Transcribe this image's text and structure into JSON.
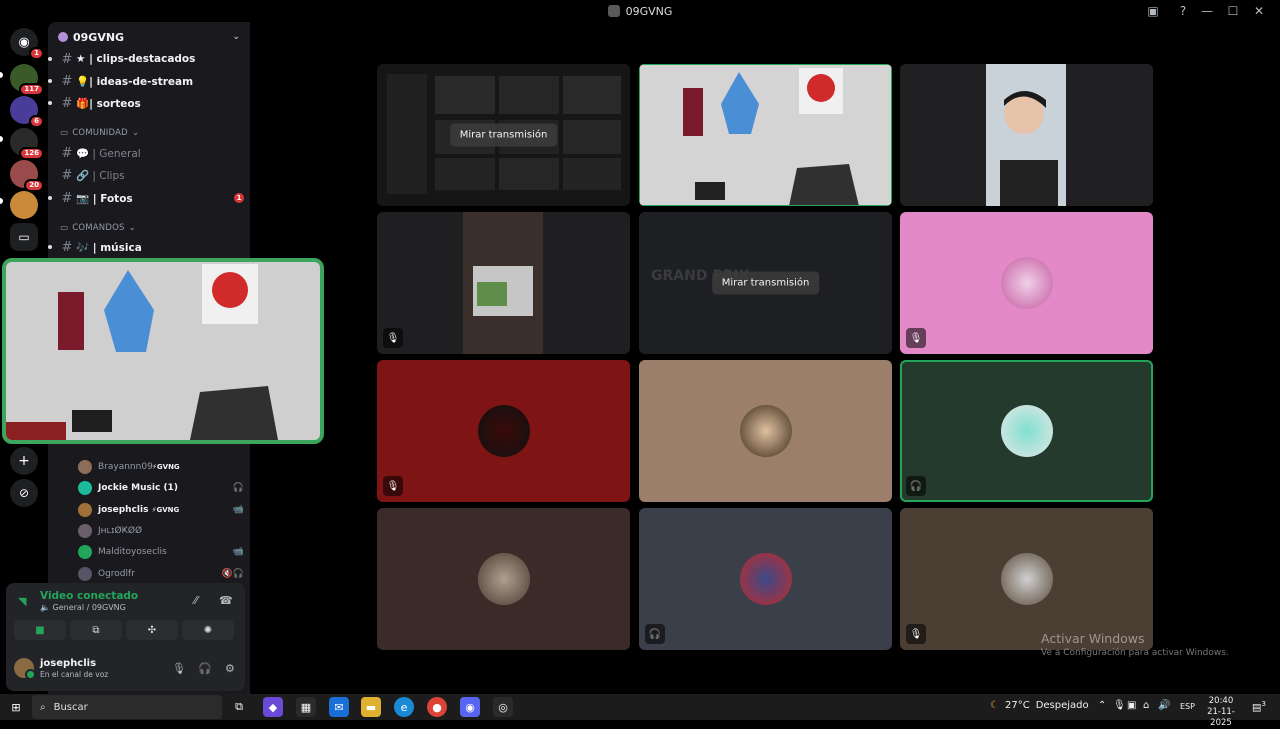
{
  "window": {
    "title": "09GVNG"
  },
  "rail": {
    "badges": [
      "1",
      "117",
      "6",
      "126",
      "20"
    ]
  },
  "guild": {
    "name": "09GVNG"
  },
  "channels": [
    {
      "name": "★ | clips-destacados",
      "muted": false
    },
    {
      "name": "💡| ideas-de-stream",
      "muted": false
    },
    {
      "name": "🎁| sorteos",
      "muted": false
    }
  ],
  "categories": {
    "comunidad": "COMUNIDAD",
    "comandos": "COMANDOS"
  },
  "comunidad_channels": [
    {
      "name": "💬 | General",
      "muted": true,
      "unread": ""
    },
    {
      "name": "🔗 | Clips",
      "muted": true,
      "unread": ""
    },
    {
      "name": "📷 | Fotos",
      "muted": false,
      "unread": "1"
    }
  ],
  "comandos_channels": [
    {
      "name": "🎶 | música",
      "muted": false
    }
  ],
  "members": [
    {
      "name": "Brayannn09",
      "tag": "⚡GVNG",
      "bold": false,
      "icon": ""
    },
    {
      "name": "Jockie Music (1)",
      "tag": "",
      "bold": true,
      "icon": "🎧"
    },
    {
      "name": "josephclis",
      "tag": "⚡GVNG",
      "bold": true,
      "icon": "📹"
    },
    {
      "name": "JʜʟɪØҜØØ",
      "tag": "",
      "bold": false,
      "icon": ""
    },
    {
      "name": "Malditoyoseclis",
      "tag": "",
      "bold": false,
      "icon": "📹"
    },
    {
      "name": "Ogrodlfr",
      "tag": "",
      "bold": false,
      "icon": "🔇🎧"
    }
  ],
  "voice": {
    "status": "Video conectado",
    "channel": "General / 09GVNG"
  },
  "user": {
    "name": "josephclis",
    "status": "En el canal de voz"
  },
  "tiles": {
    "watch_label": "Mirar transmisión",
    "stream_title_text": "GRAND PRIX"
  },
  "watermark": {
    "line1": "Activar Windows",
    "line2": "Ve a Configuración para activar Windows."
  },
  "taskbar": {
    "search": "Buscar",
    "temperature": "27°C",
    "weather": "Despejado",
    "lang": "ESP",
    "time": "20:40",
    "date": "21-11-2025",
    "notif": "3"
  },
  "colors": {
    "accent_green": "#23a55a",
    "pip_border": "#3ba55d",
    "unread_red": "#da373c",
    "tile_pink": "#e389c8",
    "tile_red": "#7f1414",
    "tile_tan": "#9b7f6a",
    "tile_green": "#243a2c",
    "tile_brown": "#3a2b28",
    "tile_slate": "#3b3f4a",
    "tile_olive": "#4b3f33"
  }
}
